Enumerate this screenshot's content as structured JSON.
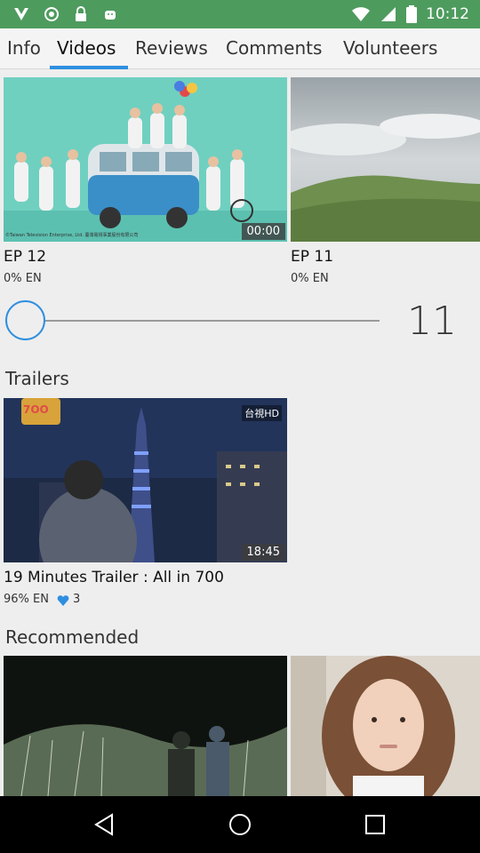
{
  "status_bar": {
    "time": "10:12",
    "icons": [
      "app-v-icon",
      "target-icon",
      "lock-icon",
      "android-icon",
      "wifi-icon",
      "signal-icon",
      "battery-icon"
    ]
  },
  "tabs": [
    {
      "label": "Info",
      "active": false
    },
    {
      "label": "Videos",
      "active": true
    },
    {
      "label": "Reviews",
      "active": false
    },
    {
      "label": "Comments",
      "active": false
    },
    {
      "label": "Volunteers",
      "active": false
    }
  ],
  "episodes": [
    {
      "title": "EP 12",
      "meta": "0% EN",
      "duration": "00:00",
      "thumb_caption": "©Taiwan Television Enterprise, Ltd. 臺灣電視事業股份有限公司"
    },
    {
      "title": "EP 11",
      "meta": "0% EN"
    }
  ],
  "slider": {
    "value": "11",
    "progress": 0
  },
  "trailers": {
    "heading": "Trailers",
    "items": [
      {
        "title": "19 Minutes Trailer : All in 700",
        "meta": "96% EN",
        "likes": "3",
        "duration": "18:45",
        "logo_text": "台視HD"
      }
    ]
  },
  "recommended": {
    "heading": "Recommended"
  },
  "colors": {
    "accent": "#2e8fe0",
    "status_bar": "#4e9b5e",
    "background": "#eeeeee"
  }
}
